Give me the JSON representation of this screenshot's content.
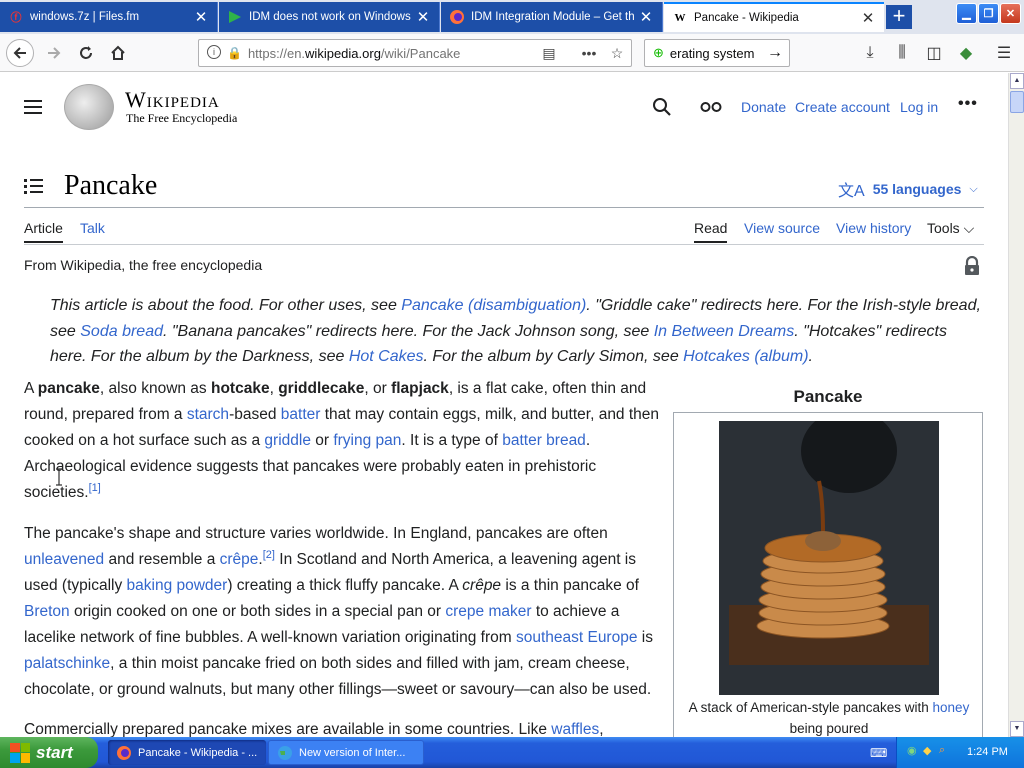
{
  "browser": {
    "tabs": [
      {
        "title": "windows.7z | Files.fm",
        "favicon": "files-fm-icon",
        "active": false
      },
      {
        "title": "IDM does not work on Windows XP",
        "favicon": "idm-icon",
        "active": false
      },
      {
        "title": "IDM Integration Module – Get this",
        "favicon": "firefox-icon",
        "active": false
      },
      {
        "title": "Pancake - Wikipedia",
        "favicon": "wikipedia-icon",
        "active": true
      }
    ],
    "url_prefix": "https://en.",
    "url_host": "wikipedia.org",
    "url_path": "/wiki/Pancake",
    "search_text": "erating system",
    "colors": {
      "tab_inactive": "#1d4fa8",
      "accent": "#0a84ff",
      "secure": "#12bc00"
    }
  },
  "wiki": {
    "wordmark": "Wikipedia",
    "tagline": "The Free Encyclopedia",
    "header_links": {
      "donate": "Donate",
      "create_account": "Create account",
      "log_in": "Log in"
    },
    "title": "Pancake",
    "languages": "55 languages",
    "page_tabs": {
      "article": "Article",
      "talk": "Talk"
    },
    "view_tabs": {
      "read": "Read",
      "view_source": "View source",
      "view_history": "View history",
      "tools": "Tools"
    },
    "from": "From Wikipedia, the free encyclopedia",
    "hatnote": {
      "t1": "This article is about the food. For other uses, see ",
      "l1": "Pancake (disambiguation)",
      "t2": ". \"Griddle cake\" redirects here. For the Irish-style bread, see ",
      "l2": "Soda bread",
      "t3": ". \"Banana pancakes\" redirects here. For the Jack Johnson song, see ",
      "l3": "In Between Dreams",
      "t4": ". \"Hotcakes\" redirects here. For the album by the Darkness, see ",
      "l4": "Hot Cakes",
      "t5": ". For the album by Carly Simon, see ",
      "l5": "Hotcakes (album)",
      "t6": "."
    },
    "p1": {
      "a": "A ",
      "b1": "pancake",
      "c": ", also known as ",
      "b2": "hotcake",
      "d": ", ",
      "b3": "griddlecake",
      "e": ", or ",
      "b4": "flapjack",
      "f": ", is a flat cake, often thin and round, prepared from a ",
      "l1": "starch",
      "g": "-based ",
      "l2": "batter",
      "h": " that may contain eggs, milk, and butter, and then cooked on a hot surface such as a ",
      "l3": "griddle",
      "i": " or ",
      "l4": "frying pan",
      "j": ". It is a type of ",
      "l5": "batter bread",
      "k": ". Archaeological evidence suggests that pancakes were probably eaten in prehistoric societies.",
      "ref": "[1]"
    },
    "p2": {
      "a": "The pancake's shape and structure varies worldwide. In England, pancakes are often ",
      "l1": "unleavened",
      "b": " and resemble a ",
      "l2": "crêpe",
      "c": ".",
      "ref": "[2]",
      "d": " In Scotland and North America, a leavening agent is used (typically ",
      "l3": "baking powder",
      "e": ") creating a thick fluffy pancake. A ",
      "i1": "crêpe",
      "f": " is a thin pancake of ",
      "l4": "Breton",
      "g": " origin cooked on one or both sides in a special pan or ",
      "l5": "crepe maker",
      "h": " to achieve a lacelike network of fine bubbles. A well-known variation originating from ",
      "l6": "southeast Europe",
      "j": " is ",
      "l7": "palatschinke",
      "k": ", a thin moist pancake fried on both sides and filled with jam, cream cheese, chocolate, or ground walnuts, but many other fillings—sweet or savoury—can also be used."
    },
    "p3": {
      "a": "Commercially prepared pancake mixes are available in some countries. Like ",
      "l1": "waffles",
      "b": ","
    },
    "infobox": {
      "title": "Pancake",
      "caption_a": "A stack of American-style pancakes with ",
      "caption_link": "honey",
      "caption_b": " being poured"
    }
  },
  "taskbar": {
    "start": "start",
    "items": [
      {
        "label": "Pancake - Wikipedia - ...",
        "active": true
      },
      {
        "label": "New version of Inter...",
        "active": false
      }
    ],
    "clock": "1:24 PM"
  }
}
